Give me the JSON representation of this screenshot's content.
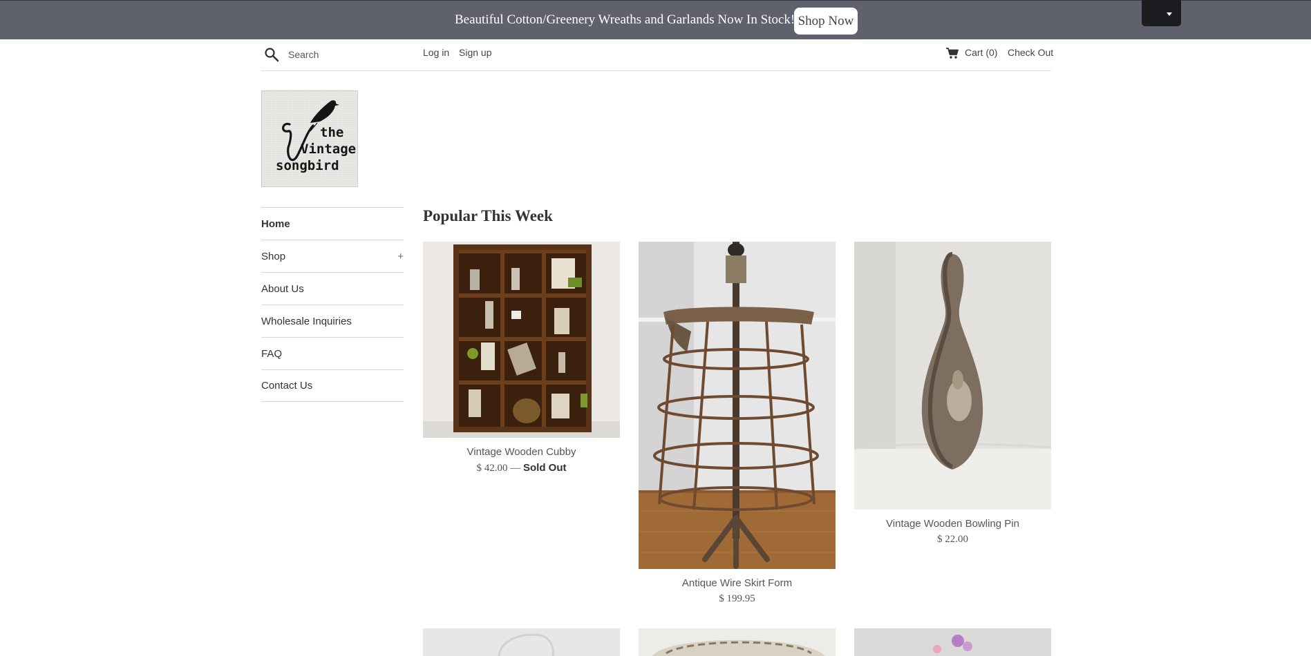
{
  "announcement": {
    "text": "Beautiful Cotton/Greenery Wreaths and Garlands Now In Stock!",
    "button_label": "Shop Now"
  },
  "header": {
    "search_placeholder": "Search",
    "login": "Log in",
    "signup": "Sign up",
    "cart": "Cart (0)",
    "checkout": "Check Out"
  },
  "logo": {
    "line1": "the",
    "line2": "Vintage",
    "line3": "songbird"
  },
  "sidebar": {
    "items": [
      {
        "label": "Home",
        "active": true
      },
      {
        "label": "Shop",
        "expand": "+"
      },
      {
        "label": "About Us"
      },
      {
        "label": "Wholesale Inquiries"
      },
      {
        "label": "FAQ"
      },
      {
        "label": "Contact Us"
      }
    ]
  },
  "main": {
    "section_title": "Popular This Week",
    "products": [
      {
        "name": "Vintage Wooden Cubby",
        "price": "$ 42.00",
        "separator": " — ",
        "status": "Sold Out"
      },
      {
        "name": "Antique Wire Skirt Form",
        "price": "$ 199.95"
      },
      {
        "name": "Vintage Wooden Bowling Pin",
        "price": "$ 22.00"
      }
    ]
  },
  "colors": {
    "announcement_bg": "#5f626d",
    "currency_bg": "#1c1d21",
    "divider": "#d6d6d6"
  }
}
